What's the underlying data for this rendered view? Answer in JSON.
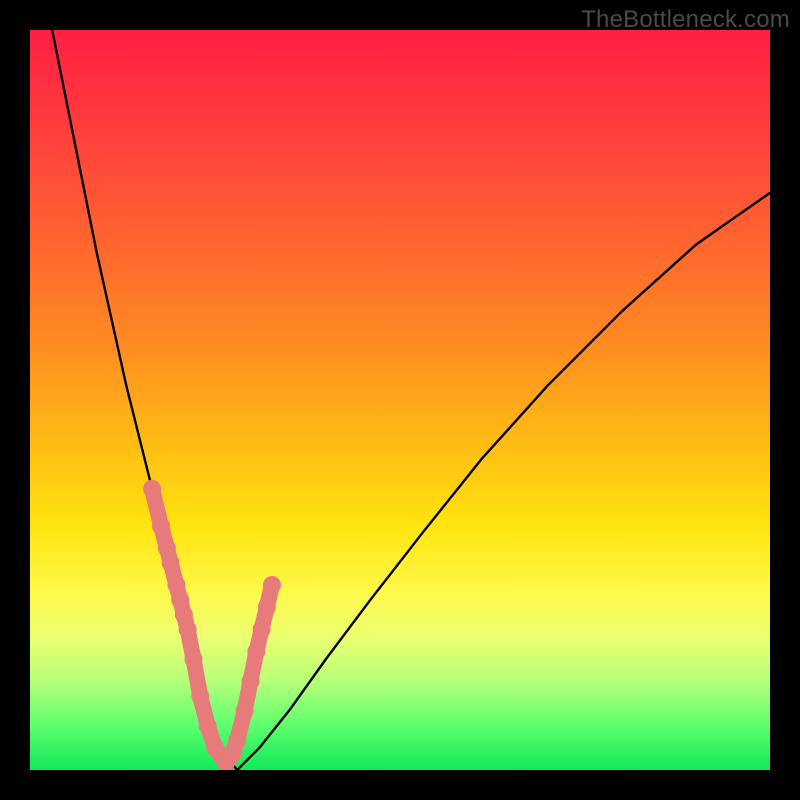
{
  "watermark": "TheBottleneck.com",
  "chart_data": {
    "type": "line",
    "title": "",
    "xlabel": "",
    "ylabel": "",
    "xlim": [
      0,
      100
    ],
    "ylim": [
      0,
      100
    ],
    "grid": false,
    "legend": false,
    "series": [
      {
        "name": "bottleneck-curve",
        "x": [
          3,
          5,
          7,
          9,
          11,
          13,
          15,
          17,
          19,
          21,
          22.5,
          24,
          25.5,
          28,
          31,
          35,
          40,
          46,
          53,
          61,
          70,
          80,
          90,
          100
        ],
        "y": [
          100,
          90,
          80,
          70,
          61,
          52,
          44,
          36,
          28,
          20,
          14,
          8,
          3,
          0,
          3,
          8,
          15,
          23,
          32,
          42,
          52,
          62,
          71,
          78
        ]
      }
    ],
    "markers": {
      "name": "highlight-segments",
      "color": "#e77b7c",
      "x": [
        16.5,
        17.7,
        18.5,
        19.0,
        19.8,
        20.3,
        20.8,
        21.3,
        22.1,
        23.0,
        24.0,
        25.0,
        25.8,
        26.5,
        27.3,
        28.0,
        29.0,
        29.8,
        30.6,
        31.3,
        32.0,
        32.7
      ],
      "y": [
        38,
        33,
        30,
        28,
        25,
        23,
        21,
        19,
        15,
        10,
        6,
        3,
        2,
        1,
        2,
        4,
        8,
        12,
        16,
        19,
        22,
        25
      ]
    },
    "gradient_stops": [
      {
        "pos": 0.0,
        "color": "#ff1f42"
      },
      {
        "pos": 0.12,
        "color": "#ff3a3e"
      },
      {
        "pos": 0.28,
        "color": "#ff6330"
      },
      {
        "pos": 0.42,
        "color": "#ff8a22"
      },
      {
        "pos": 0.55,
        "color": "#ffb915"
      },
      {
        "pos": 0.67,
        "color": "#ffe40f"
      },
      {
        "pos": 0.76,
        "color": "#fff94b"
      },
      {
        "pos": 0.82,
        "color": "#ecff6f"
      },
      {
        "pos": 0.88,
        "color": "#b6ff7a"
      },
      {
        "pos": 0.94,
        "color": "#5dff6d"
      },
      {
        "pos": 1.0,
        "color": "#12e85a"
      }
    ]
  }
}
